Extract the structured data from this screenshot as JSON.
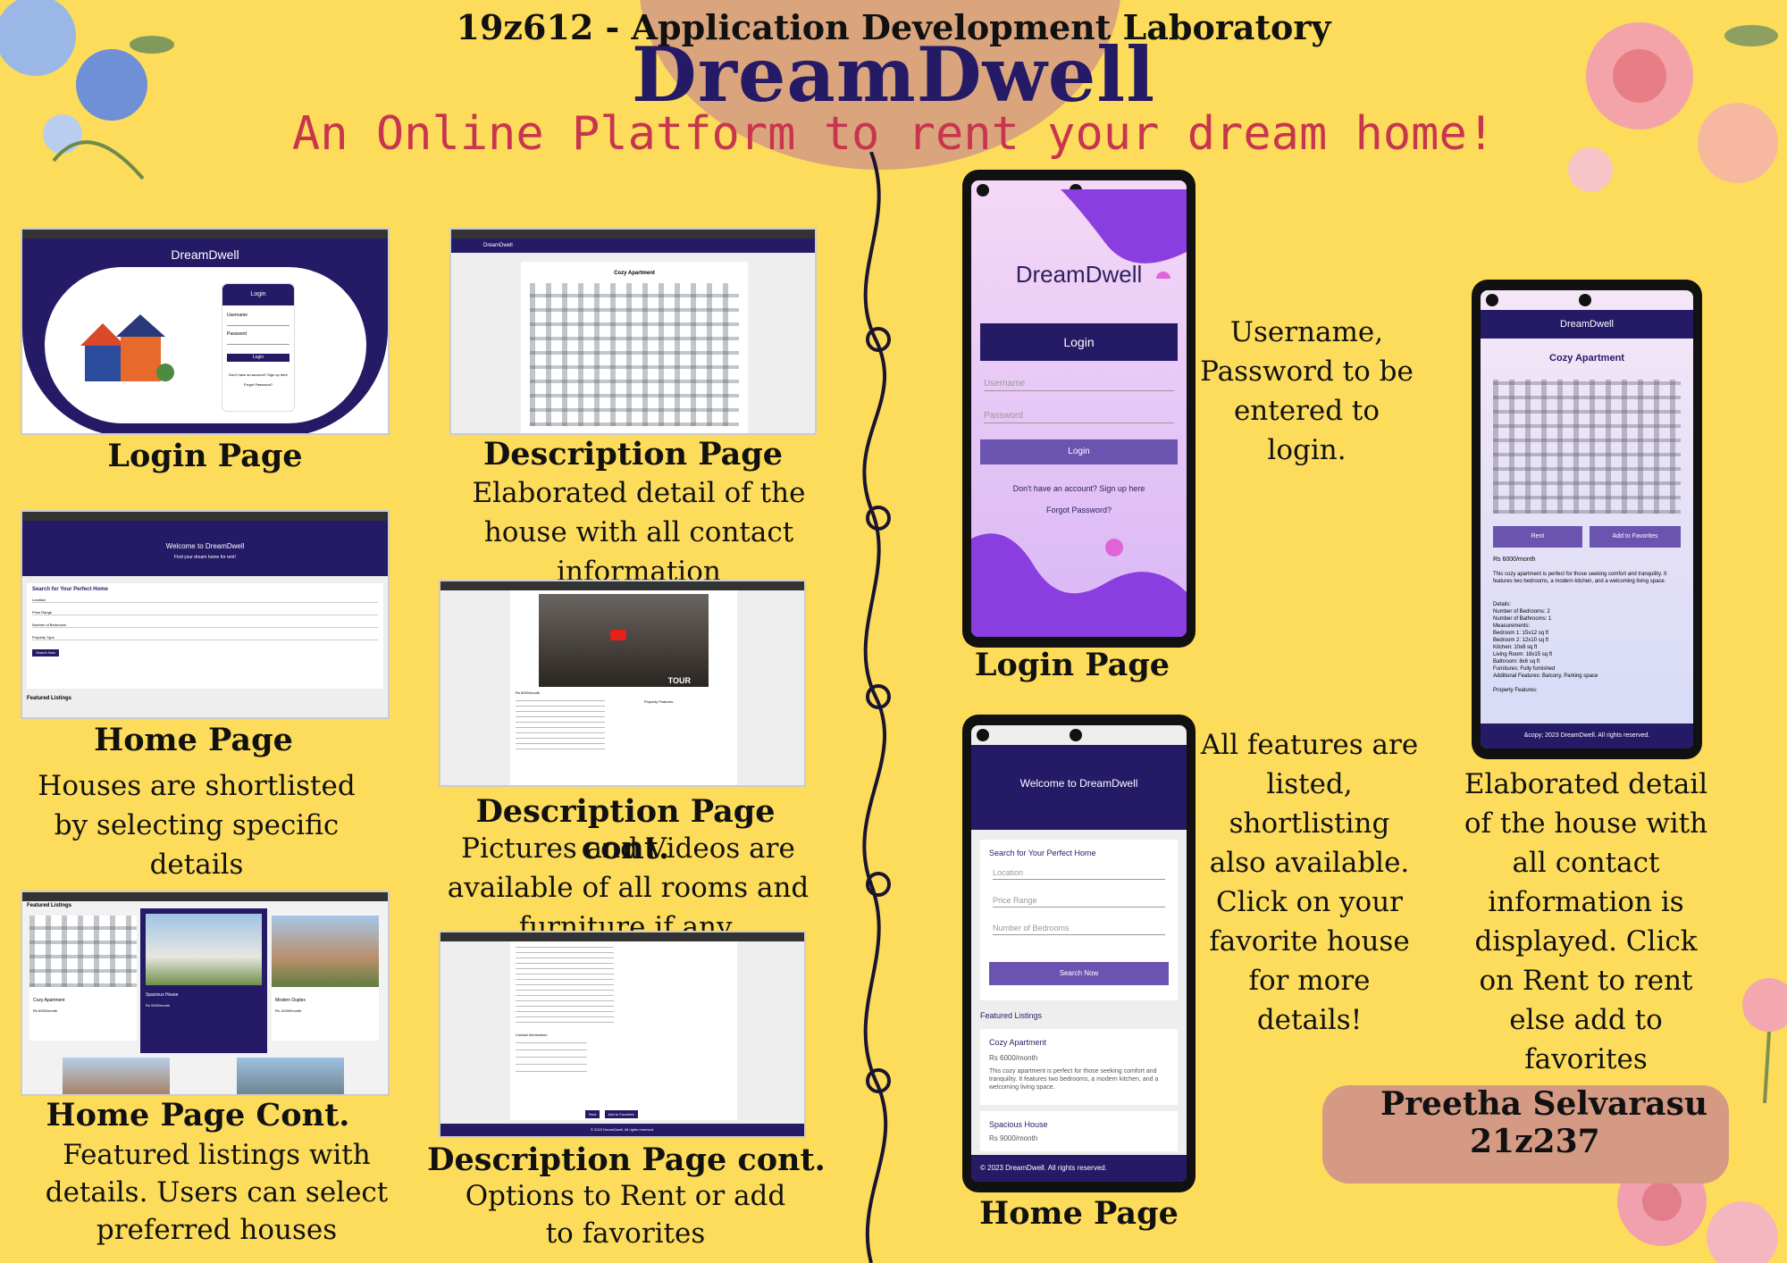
{
  "header": {
    "course": "19z612 - Application Development Laboratory",
    "brand": "DreamDwell",
    "tagline": "An Online Platform to rent your dream home!"
  },
  "left_panels": [
    {
      "heading": "Login Page",
      "desc": ""
    },
    {
      "heading": "Description Page",
      "desc": "Elaborated detail of the house with all contact information"
    },
    {
      "heading": "Home Page",
      "desc": "Houses are shortlisted by selecting specific details"
    },
    {
      "heading": "Description Page cont.",
      "desc": "Pictures and Videos are available of all rooms and furniture if any."
    },
    {
      "heading": "Home Page Cont.",
      "desc": "Featured listings with details. Users can select preferred houses"
    },
    {
      "heading": "Description Page cont.",
      "desc": "Options to Rent or add to favorites"
    }
  ],
  "web_login": {
    "app_title": "DreamDwell",
    "card_title": "Login",
    "username_label": "Username",
    "password_label": "Password",
    "button": "Login",
    "signup": "Don't have an account? Sign up here",
    "forgot": "Forgot Password?"
  },
  "web_desc": {
    "app_title": "DreamDwell",
    "card_title": "Cozy Apartment"
  },
  "web_home": {
    "welcome": "Welcome to DreamDwell",
    "sub": "Find your dream home for rent!",
    "search_title": "Search for Your Perfect Home",
    "fields": [
      "Location",
      "Price Range",
      "Number of Bedrooms",
      "Property Type"
    ],
    "button": "Search Now",
    "featured": "Featured Listings"
  },
  "web_listings": {
    "featured": "Featured Listings",
    "items": [
      {
        "title": "Cozy Apartment",
        "price": "Rs 6000/month"
      },
      {
        "title": "Spacious House",
        "price": "Rs 9000/month"
      },
      {
        "title": "Modern Duplex",
        "price": "Rs 12000/month"
      }
    ]
  },
  "web_video": {
    "video_label": "TOUR",
    "price": "Rs 6000/month",
    "features_title": "Property Features:"
  },
  "web_desc3": {
    "contact_title": "Contact Information:",
    "rent": "Rent",
    "fav": "Add to Favorites",
    "footer": "© 2023 DreamDwell. All rights reserved."
  },
  "mobile_login": {
    "app_title": "DreamDwell",
    "header": "Login",
    "username": "Username",
    "password": "Password",
    "button": "Login",
    "signup": "Don't have an account? Sign up here",
    "forgot": "Forgot Password?",
    "caption": "Login Page",
    "note": "Username, Password to be entered to login."
  },
  "mobile_home": {
    "welcome": "Welcome to DreamDwell",
    "search_title": "Search for Your Perfect Home",
    "location": "Location",
    "price": "Price Range",
    "bedrooms": "Number of Bedrooms",
    "button": "Search Now",
    "featured": "Featured Listings",
    "item1_title": "Cozy Apartment",
    "item1_price": "Rs 6000/month",
    "item1_text": "This cozy apartment is perfect for those seeking comfort and tranquility. It features two bedrooms, a modern kitchen, and a welcoming living space.",
    "item2_title": "Spacious House",
    "item2_price": "Rs 9000/month",
    "footer": "© 2023 DreamDwell. All rights reserved.",
    "caption": "Home Page",
    "note": "All features are listed, shortlisting also available. Click on your favorite house for more details!"
  },
  "mobile_desc": {
    "app_title": "DreamDwell",
    "title": "Cozy Apartment",
    "rent": "Rent",
    "fav": "Add to Favorites",
    "price": "Rs 6000/month",
    "text": "This cozy apartment is perfect for those seeking comfort and tranquility. It features two bedrooms, a modern kitchen, and a welcoming living space.",
    "details": [
      "Details:",
      "Number of Bedrooms: 2",
      "Number of Bathrooms: 1",
      "Measurements:",
      "Bedroom 1: 15x12 sq ft",
      "Bedroom 2: 12x10 sq ft",
      "Kitchen: 10x8 sq ft",
      "Living Room: 18x15 sq ft",
      "Bathroom: 8x6 sq ft",
      "Furnitures: Fully furnished",
      "Additional Features: Balcony, Parking space",
      "",
      "Property Features:"
    ],
    "footer": "&copy; 2023 DreamDwell. All rights reserved.",
    "note": "Elaborated detail of the house with all contact information is displayed. Click on Rent to rent else add to favorites"
  },
  "author": {
    "name": "Preetha Selvarasu",
    "roll": "21z237"
  },
  "colors": {
    "background": "#fcdc5a",
    "navy": "#241a66",
    "tagline": "#c8354e",
    "badge": "#d49a84"
  }
}
